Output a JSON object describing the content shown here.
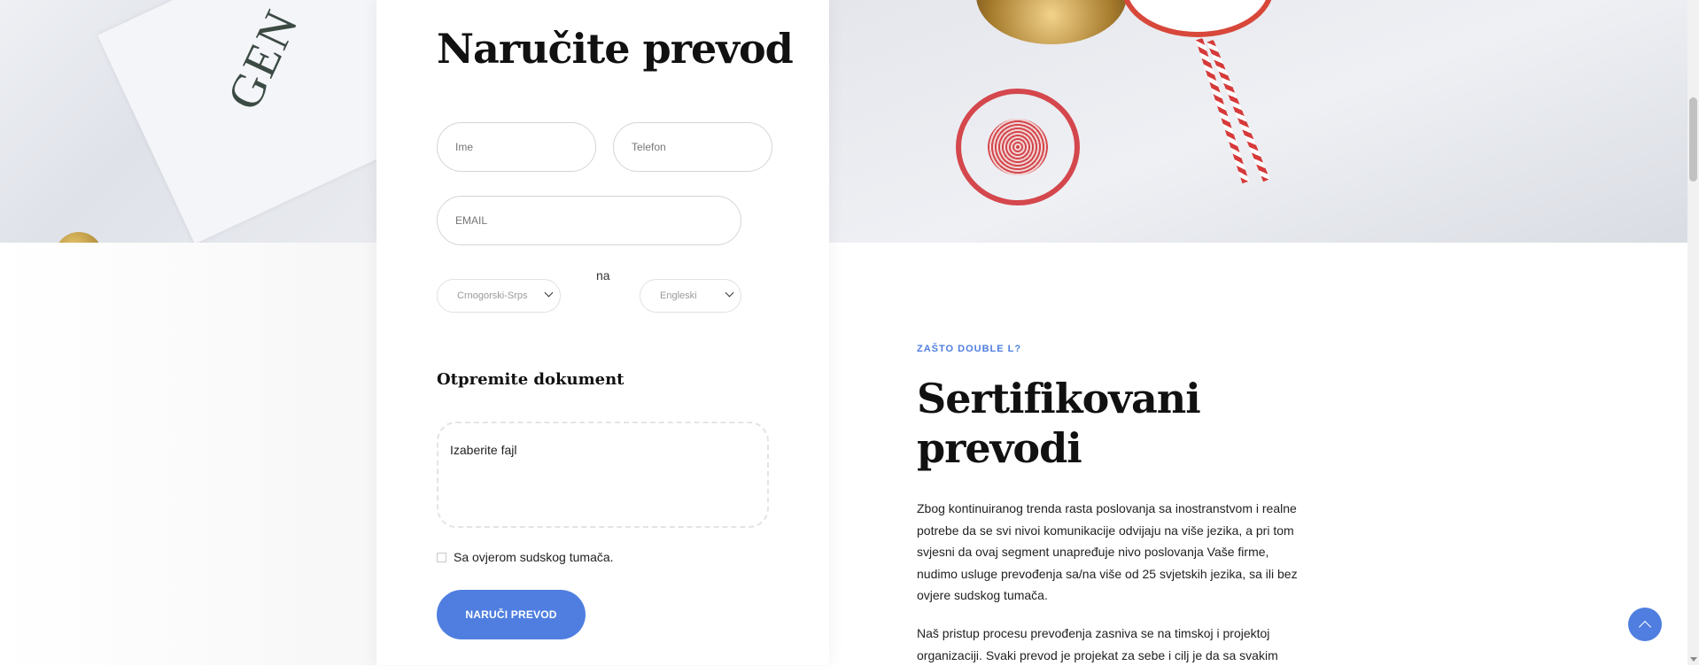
{
  "form": {
    "title": "Naručite prevod",
    "name_placeholder": "Ime",
    "phone_placeholder": "Telefon",
    "email_placeholder": "EMAIL",
    "source_language": "Crnogorski-Srps",
    "connector": "na",
    "target_language": "Engleski",
    "upload_heading": "Otpremite dokument",
    "upload_label": "Izaberite fajl",
    "certification_label": "Sa ovjerom sudskog tumača.",
    "certification_checked": false,
    "submit_label": "NARUČI PREVOD"
  },
  "about": {
    "eyebrow": "ZAŠTO DOUBLE L?",
    "title": "Sertifikovani prevodi",
    "paragraph1": "Zbog kontinuiranog trenda rasta poslovanja sa inostranstvom i realne potrebe da se svi nivoi komunikacije odvijaju na više jezika, a pri tom svjesni da ovaj segment unapređuje nivo poslovanja Vaše firme, nudimo usluge prevođenja sa/na više od 25 svjetskih jezika, sa ili bez ovjere sudskog tumača.",
    "paragraph2": "Naš pristup procesu prevođenja zasniva se na timskoj i projektoj organizaciji. Svaki prevod je projekat za sebe i cilj je da sa svakim"
  },
  "colors": {
    "accent": "#4f7ee0",
    "heading": "#111111"
  },
  "icons": {
    "back_to_top": "chevron-up-icon",
    "select_arrow": "chevron-down-icon"
  }
}
